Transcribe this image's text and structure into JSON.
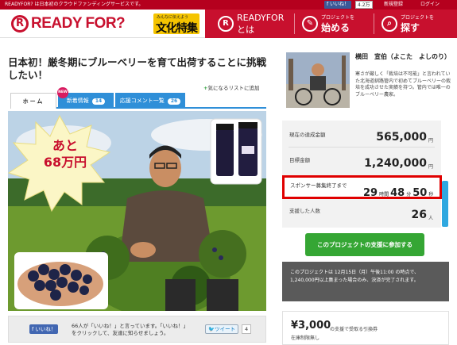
{
  "topbar": {
    "tagline": "READYFOR? は日本初のクラウドファンディングサービスです。",
    "fb_like": "いいね！",
    "fb_count": "4.2万",
    "signup": "新規登録",
    "login": "ログイン"
  },
  "header": {
    "logo_text": "READY FOR?",
    "banner_small": "みんなに伝えよう",
    "banner_big": "文化特集",
    "nav": [
      {
        "line1": "READYFOR",
        "line2": "とは"
      },
      {
        "line1": "プロジェクトを",
        "line2": "始める"
      },
      {
        "line1": "プロジェクトを",
        "line2": "探す"
      }
    ]
  },
  "project": {
    "title": "日本初！厳冬期にブルーベリーを育て出荷することに挑戦したい！",
    "favorite": "気になるリストに追加",
    "tabs": {
      "home": "ホーム",
      "news_label": "新着情報",
      "news_count": "14",
      "comments_label": "応援コメント一覧",
      "comments_count": "26",
      "new_badge": "NEW"
    },
    "burst_line1": "あと",
    "burst_line2": "68万円"
  },
  "social": {
    "like_button": "いいね！",
    "like_text": "66人が「いいね！」と言っています。「いいね！」をクリックして、友達に知らせましょう。",
    "tweet_button": "ツイート",
    "tweet_count": "4"
  },
  "owner": {
    "name": "横田　宣伯（よこた　よしのり）",
    "description": "寒さが厳しく「栽培は不可能」と言われていた北海道釧路管内で初めてブルーベリーの栽培を成功させた実績を持つ。管内では唯一のブルーベリー農家。"
  },
  "stats": {
    "current_label": "現在の達成金額",
    "current_value": "565,000",
    "target_label": "目標金額",
    "target_value": "1,240,000",
    "unit_yen": "円",
    "deadline_label": "スポンサー募集終了まで",
    "hours": "29",
    "hours_unit": "時間",
    "minutes": "48",
    "minutes_unit": "分",
    "seconds": "50",
    "seconds_unit": "秒",
    "supporters_label": "支援した人数",
    "supporters_value": "26",
    "supporters_unit": "人"
  },
  "support_button": "このプロジェクトの支援に参加する",
  "notice": "このプロジェクトは 12月15日（月）午後11:00 の時点で、1,240,000円以上集まった場合のみ、決済が完了されます。",
  "reward": {
    "price": "¥3,000",
    "description": "の支援で受取る引換券",
    "stock": "在庫制限無し"
  },
  "colors": {
    "brand_red": "#c8102e",
    "tab_blue": "#2f8fd8",
    "support_green": "#35a634",
    "timer_border": "#e00000"
  }
}
